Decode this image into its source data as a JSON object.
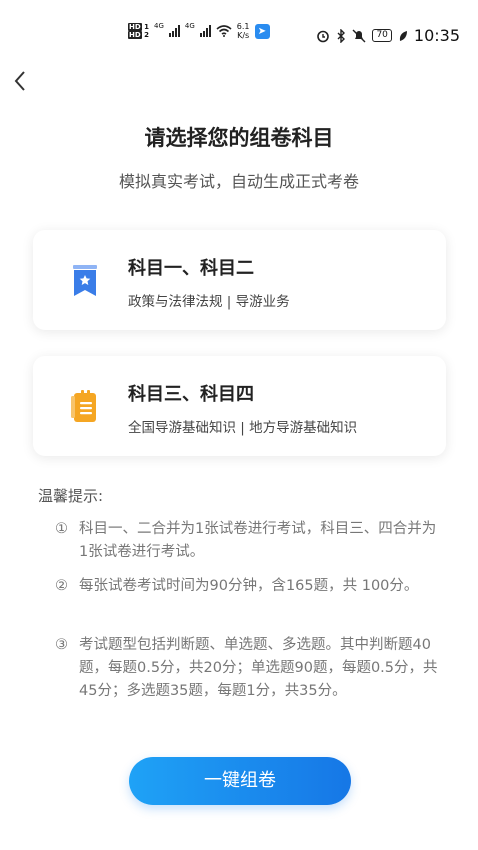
{
  "statusbar": {
    "hd1": "HD",
    "hd1_num": "1",
    "hd2": "HD",
    "hd2_num": "2",
    "net1": "4G",
    "net2": "4G",
    "speed_value": "6.1",
    "speed_unit": "K/s",
    "battery": "70",
    "time": "10:35",
    "icons": [
      "alarm-icon",
      "bluetooth-icon",
      "mute-icon",
      "battery-icon",
      "leaf-icon"
    ]
  },
  "header": {
    "back_icon": "chevron-left-icon",
    "title": "请选择您的组卷科目",
    "subtitle": "模拟真实考试，自动生成正式考卷"
  },
  "cards": [
    {
      "title": "科目一、科目二",
      "subtitle": "政策与法律法规 | 导游业务",
      "icon": "bookmark-star-icon",
      "icon_color": "#3a7de8"
    },
    {
      "title": "科目三、科目四",
      "subtitle": "全国导游基础知识 | 地方导游基础知识",
      "icon": "notepad-icon",
      "icon_color": "#f5a623"
    }
  ],
  "tips": {
    "title": "温馨提示:",
    "items": [
      {
        "num": "①",
        "text": "科目一、二合并为1张试卷进行考试，科目三、四合并为1张试卷进行考试。"
      },
      {
        "num": "②",
        "text": "每张试卷考试时间为90分钟，含165题，共 100分。"
      },
      {
        "num": "③",
        "text": "考试题型包括判断题、单选题、多选题。其中判断题40题，每题0.5分，共20分；单选题90题，每题0.5分，共45分；多选题35题，每题1分，共35分。"
      }
    ]
  },
  "action": {
    "button_label": "一键组卷",
    "button_color": "#1a8cf0"
  }
}
